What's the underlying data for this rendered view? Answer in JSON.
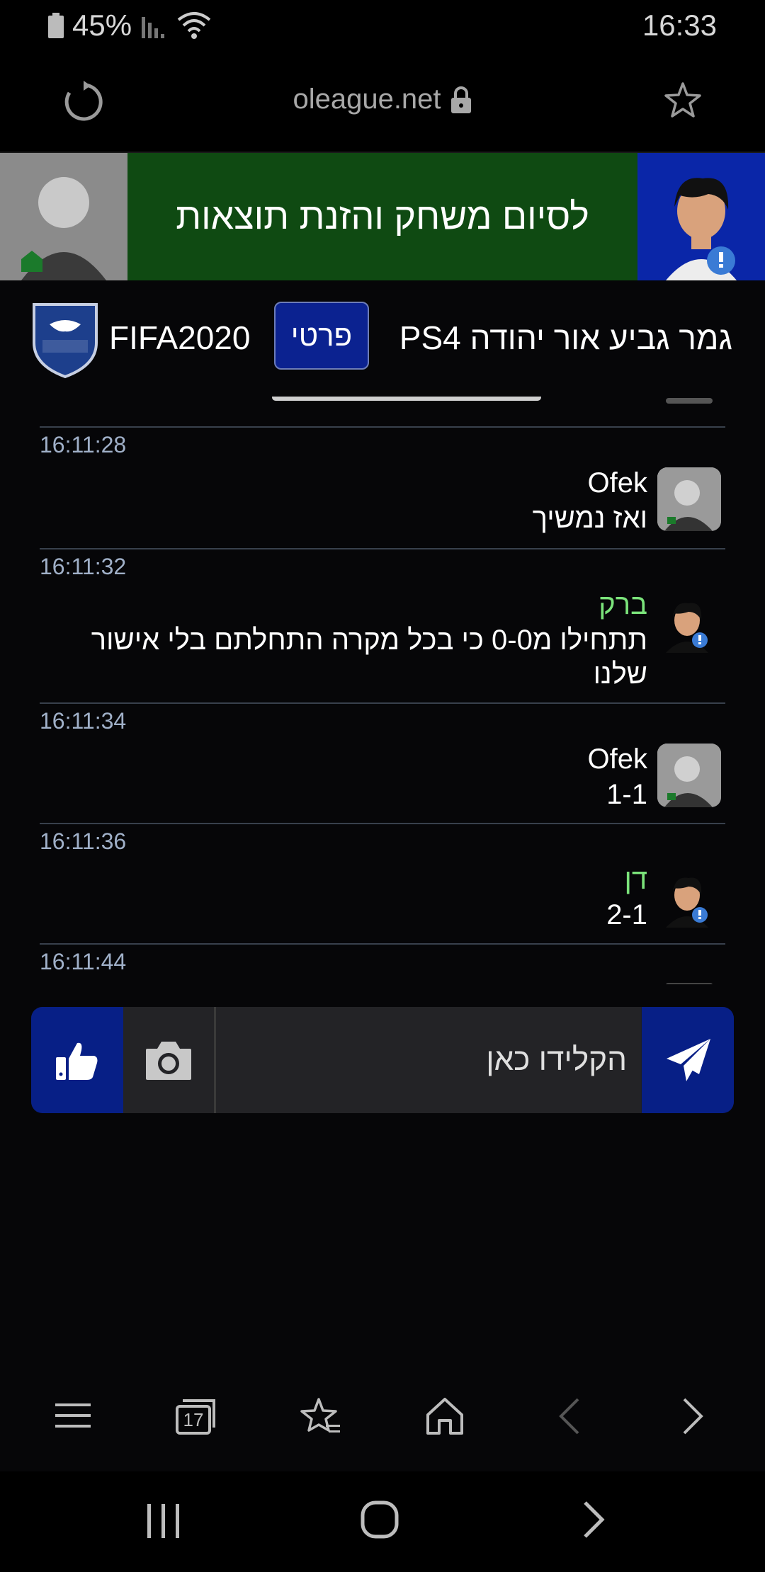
{
  "status_bar": {
    "battery": "45%",
    "time": "16:33"
  },
  "browser": {
    "url": "oleague.net"
  },
  "banner": {
    "title": "לסיום משחק והזנת תוצאות"
  },
  "league": {
    "game": "FIFA2020",
    "tag": "פרטי",
    "title": "גמר גביע אור יהודה PS4"
  },
  "messages": [
    {
      "time": "16:11:28",
      "author": "Ofek",
      "text": "ואז נמשיך",
      "avatar": "photo"
    },
    {
      "time": "16:11:32",
      "author": "ברק",
      "text": "תתחילו מ0-0 כי בכל מקרה התחלתם בלי אישור שלנו",
      "avatar": "default"
    },
    {
      "time": "16:11:34",
      "author": "Ofek",
      "text": "1-1",
      "avatar": "photo"
    },
    {
      "time": "16:11:36",
      "author": "דן",
      "text": "2-1",
      "avatar": "default"
    },
    {
      "time": "16:11:44"
    }
  ],
  "input": {
    "placeholder": "הקלידו כאן"
  },
  "browser_toolbar": {
    "tabs_count": "17"
  },
  "colors": {
    "accent_blue": "#071f86",
    "banner_green": "#0f4a12",
    "admin_name": "#7be37b",
    "divider": "#38404c"
  },
  "icons": [
    "battery-icon",
    "signal-icon",
    "wifi-icon",
    "reload-icon",
    "lock-icon",
    "bookmark-star-icon",
    "thumbs-up-icon",
    "camera-icon",
    "send-icon",
    "menu-icon",
    "tabs-icon",
    "bookmarks-icon",
    "home-icon",
    "back-icon",
    "forward-icon",
    "recents-icon",
    "home-circle-icon",
    "system-back-icon"
  ]
}
